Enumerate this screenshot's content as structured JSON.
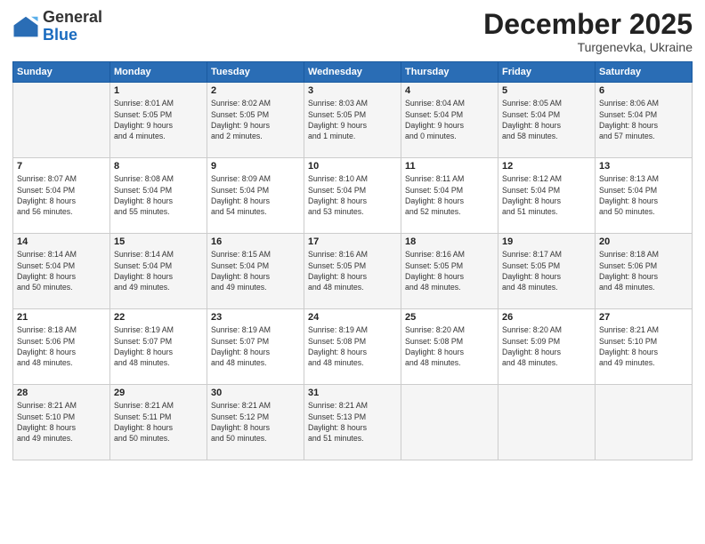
{
  "header": {
    "logo_general": "General",
    "logo_blue": "Blue",
    "month": "December 2025",
    "location": "Turgenevka, Ukraine"
  },
  "days_of_week": [
    "Sunday",
    "Monday",
    "Tuesday",
    "Wednesday",
    "Thursday",
    "Friday",
    "Saturday"
  ],
  "weeks": [
    [
      {
        "day": "",
        "info": ""
      },
      {
        "day": "1",
        "info": "Sunrise: 8:01 AM\nSunset: 5:05 PM\nDaylight: 9 hours\nand 4 minutes."
      },
      {
        "day": "2",
        "info": "Sunrise: 8:02 AM\nSunset: 5:05 PM\nDaylight: 9 hours\nand 2 minutes."
      },
      {
        "day": "3",
        "info": "Sunrise: 8:03 AM\nSunset: 5:05 PM\nDaylight: 9 hours\nand 1 minute."
      },
      {
        "day": "4",
        "info": "Sunrise: 8:04 AM\nSunset: 5:04 PM\nDaylight: 9 hours\nand 0 minutes."
      },
      {
        "day": "5",
        "info": "Sunrise: 8:05 AM\nSunset: 5:04 PM\nDaylight: 8 hours\nand 58 minutes."
      },
      {
        "day": "6",
        "info": "Sunrise: 8:06 AM\nSunset: 5:04 PM\nDaylight: 8 hours\nand 57 minutes."
      }
    ],
    [
      {
        "day": "7",
        "info": "Sunrise: 8:07 AM\nSunset: 5:04 PM\nDaylight: 8 hours\nand 56 minutes."
      },
      {
        "day": "8",
        "info": "Sunrise: 8:08 AM\nSunset: 5:04 PM\nDaylight: 8 hours\nand 55 minutes."
      },
      {
        "day": "9",
        "info": "Sunrise: 8:09 AM\nSunset: 5:04 PM\nDaylight: 8 hours\nand 54 minutes."
      },
      {
        "day": "10",
        "info": "Sunrise: 8:10 AM\nSunset: 5:04 PM\nDaylight: 8 hours\nand 53 minutes."
      },
      {
        "day": "11",
        "info": "Sunrise: 8:11 AM\nSunset: 5:04 PM\nDaylight: 8 hours\nand 52 minutes."
      },
      {
        "day": "12",
        "info": "Sunrise: 8:12 AM\nSunset: 5:04 PM\nDaylight: 8 hours\nand 51 minutes."
      },
      {
        "day": "13",
        "info": "Sunrise: 8:13 AM\nSunset: 5:04 PM\nDaylight: 8 hours\nand 50 minutes."
      }
    ],
    [
      {
        "day": "14",
        "info": "Sunrise: 8:14 AM\nSunset: 5:04 PM\nDaylight: 8 hours\nand 50 minutes."
      },
      {
        "day": "15",
        "info": "Sunrise: 8:14 AM\nSunset: 5:04 PM\nDaylight: 8 hours\nand 49 minutes."
      },
      {
        "day": "16",
        "info": "Sunrise: 8:15 AM\nSunset: 5:04 PM\nDaylight: 8 hours\nand 49 minutes."
      },
      {
        "day": "17",
        "info": "Sunrise: 8:16 AM\nSunset: 5:05 PM\nDaylight: 8 hours\nand 48 minutes."
      },
      {
        "day": "18",
        "info": "Sunrise: 8:16 AM\nSunset: 5:05 PM\nDaylight: 8 hours\nand 48 minutes."
      },
      {
        "day": "19",
        "info": "Sunrise: 8:17 AM\nSunset: 5:05 PM\nDaylight: 8 hours\nand 48 minutes."
      },
      {
        "day": "20",
        "info": "Sunrise: 8:18 AM\nSunset: 5:06 PM\nDaylight: 8 hours\nand 48 minutes."
      }
    ],
    [
      {
        "day": "21",
        "info": "Sunrise: 8:18 AM\nSunset: 5:06 PM\nDaylight: 8 hours\nand 48 minutes."
      },
      {
        "day": "22",
        "info": "Sunrise: 8:19 AM\nSunset: 5:07 PM\nDaylight: 8 hours\nand 48 minutes."
      },
      {
        "day": "23",
        "info": "Sunrise: 8:19 AM\nSunset: 5:07 PM\nDaylight: 8 hours\nand 48 minutes."
      },
      {
        "day": "24",
        "info": "Sunrise: 8:19 AM\nSunset: 5:08 PM\nDaylight: 8 hours\nand 48 minutes."
      },
      {
        "day": "25",
        "info": "Sunrise: 8:20 AM\nSunset: 5:08 PM\nDaylight: 8 hours\nand 48 minutes."
      },
      {
        "day": "26",
        "info": "Sunrise: 8:20 AM\nSunset: 5:09 PM\nDaylight: 8 hours\nand 48 minutes."
      },
      {
        "day": "27",
        "info": "Sunrise: 8:21 AM\nSunset: 5:10 PM\nDaylight: 8 hours\nand 49 minutes."
      }
    ],
    [
      {
        "day": "28",
        "info": "Sunrise: 8:21 AM\nSunset: 5:10 PM\nDaylight: 8 hours\nand 49 minutes."
      },
      {
        "day": "29",
        "info": "Sunrise: 8:21 AM\nSunset: 5:11 PM\nDaylight: 8 hours\nand 50 minutes."
      },
      {
        "day": "30",
        "info": "Sunrise: 8:21 AM\nSunset: 5:12 PM\nDaylight: 8 hours\nand 50 minutes."
      },
      {
        "day": "31",
        "info": "Sunrise: 8:21 AM\nSunset: 5:13 PM\nDaylight: 8 hours\nand 51 minutes."
      },
      {
        "day": "",
        "info": ""
      },
      {
        "day": "",
        "info": ""
      },
      {
        "day": "",
        "info": ""
      }
    ]
  ]
}
